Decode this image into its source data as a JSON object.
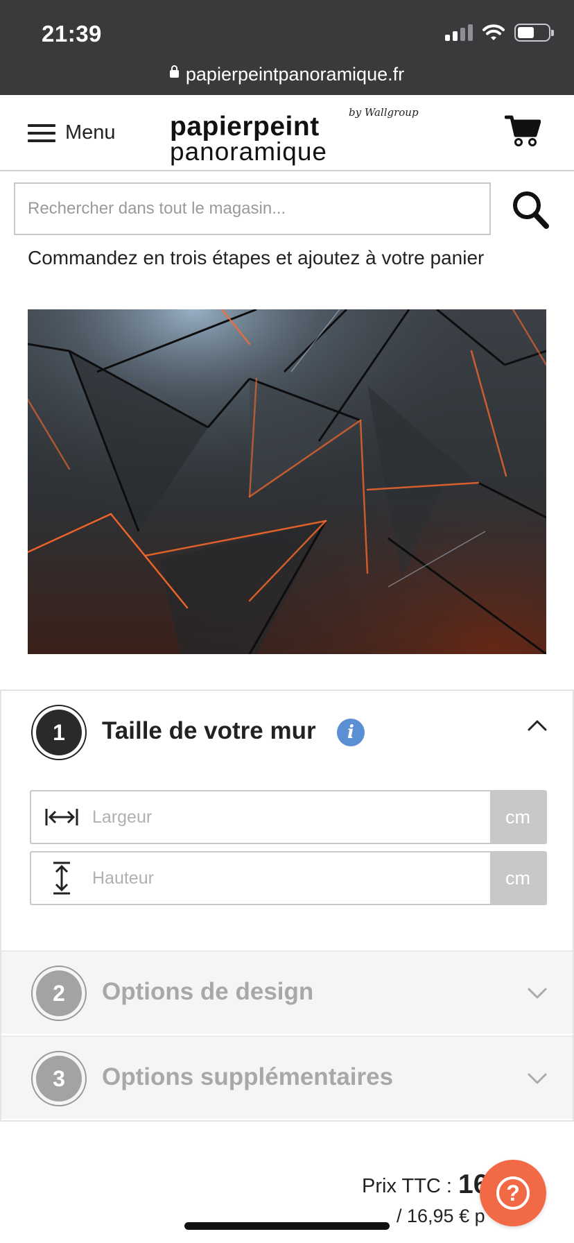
{
  "status_bar": {
    "time": "21:39"
  },
  "browser": {
    "url": "papierpeintpanoramique.fr"
  },
  "header": {
    "menu_label": "Menu",
    "logo_top": "papierpeint",
    "logo_bottom": "panoramique",
    "logo_by": "by Wallgroup"
  },
  "search": {
    "placeholder": "Rechercher dans tout le magasin..."
  },
  "intro_text": "Commandez en trois étapes et ajoutez à votre panier",
  "steps": [
    {
      "number": "1",
      "title": "Taille de votre mur",
      "expanded": true,
      "fields": [
        {
          "placeholder": "Largeur",
          "unit": "cm",
          "icon": "width-arrows-icon"
        },
        {
          "placeholder": "Hauteur",
          "unit": "cm",
          "icon": "height-arrows-icon"
        }
      ]
    },
    {
      "number": "2",
      "title": "Options de design",
      "expanded": false
    },
    {
      "number": "3",
      "title": "Options supplémentaires",
      "expanded": false
    }
  ],
  "price": {
    "label": "Prix TTC :",
    "value": "16",
    "unit_text": "/ 16,95 € p"
  },
  "colors": {
    "status_bar": "#3a3a3c",
    "info_icon": "#5b8fd4",
    "help_button": "#f26a45",
    "step_active": "#2a2a2a",
    "step_inactive": "#a3a3a3"
  }
}
